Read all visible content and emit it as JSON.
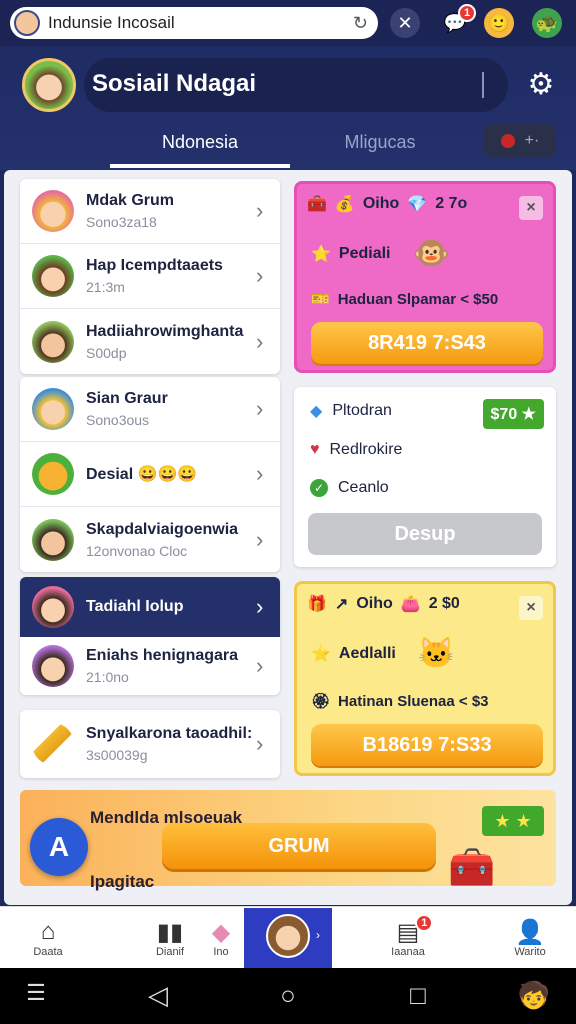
{
  "browser": {
    "url_text": "Indunsie Incosail",
    "notification_count": "1"
  },
  "header": {
    "title": "Sosiail Ndagai",
    "tabs": [
      {
        "label": "Ndonesia",
        "active": true
      },
      {
        "label": "Mligucas",
        "active": false
      }
    ],
    "tab3_glyph": "+·"
  },
  "list": [
    {
      "name": "Mdak Grum",
      "sub": "Sono3za18"
    },
    {
      "name": "Hap Icempdtaaets",
      "sub": "21:3m"
    },
    {
      "name": "Hadiiahrowimghanta",
      "sub": "S00dp"
    },
    {
      "name": "Sian Graur",
      "sub": "Sono3ous"
    },
    {
      "name": "Desial 😀😀😀",
      "sub": ""
    },
    {
      "name": "Skapdalviaigoenwia",
      "sub": "12onvonao Cloc"
    },
    {
      "name": "Tadiahl Iolup",
      "sub": ""
    },
    {
      "name": "Eniahs henignagara",
      "sub": "21:0no"
    },
    {
      "name": "Snyalkarona taoadhil:",
      "sub": "3s00039g"
    }
  ],
  "offer1": {
    "head_a": "Oiho",
    "head_b": "2 7o",
    "close": "×",
    "line1": "Pediali",
    "line2": "Haduan Slpamar < $50",
    "button": "8R419 7:S43",
    "color": "#ee6ac6"
  },
  "check": {
    "line1": "Pltodran",
    "line2": "Redlrokire",
    "line3": "Ceanlo",
    "badge": "$70 ★",
    "button": "Desup"
  },
  "offer2": {
    "head_a": "Oiho",
    "head_b": "2 $0",
    "close": "×",
    "line1": "Aedlalli",
    "line2": "Hatinan Sluenaa < $3",
    "button": "B18619 7:S33",
    "color": "#fbe98a"
  },
  "promo": {
    "line1": "Mendlda mlsoeuak",
    "line2": "Ipagitac",
    "button": "GRUM",
    "star": "★ ★"
  },
  "fab": {
    "label": "A"
  },
  "bottom_nav": [
    {
      "label": "Daata",
      "icon": "home-icon"
    },
    {
      "label": "Dianif",
      "icon": "stats-icon"
    },
    {
      "label": "Ino",
      "icon": "profile-icon"
    },
    {
      "label": "Iaanaa",
      "icon": "book-icon",
      "badge": "1"
    },
    {
      "label": "Warito",
      "icon": "person-icon"
    }
  ]
}
